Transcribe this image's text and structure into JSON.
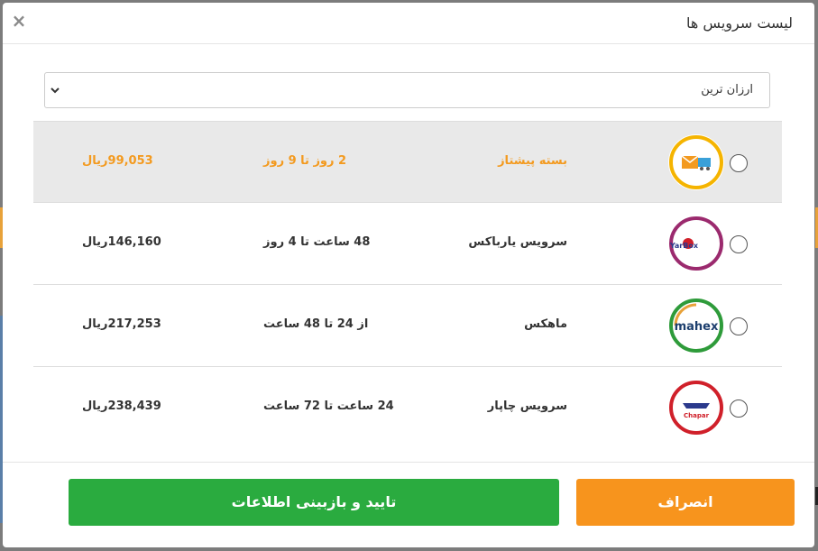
{
  "modal": {
    "title": "لیست سرویس ها",
    "close_glyph": "×"
  },
  "sort": {
    "selected": "ارزان ترین"
  },
  "services": [
    {
      "name": "بسته پیشتاز",
      "time": "2 روز تا 9 روز",
      "price": "99,053ریال",
      "logo_text": "",
      "selected": true,
      "accent": "#f39a1f"
    },
    {
      "name": "سرویس یارباکس",
      "time": "48 ساعت تا 4 روز",
      "price": "146,160ریال",
      "logo_text": "YarBox",
      "selected": false,
      "accent": "#9b2a6e"
    },
    {
      "name": "ماهکس",
      "time": "از 24 تا 48 ساعت",
      "price": "217,253ریال",
      "logo_text": "mahex",
      "selected": false,
      "accent": "#2e9b3a"
    },
    {
      "name": "سرویس چاپار",
      "time": "24 ساعت تا 72 ساعت",
      "price": "238,439ریال",
      "logo_text": "Chapar",
      "selected": false,
      "accent": "#d0202a"
    }
  ],
  "footer": {
    "cancel_label": "انصراف",
    "confirm_label": "تایید و بازبینی اطلاعات"
  },
  "colors": {
    "cancel": "#f7941d",
    "confirm": "#2aab3f",
    "selected_text": "#f39a1f"
  },
  "icons": [
    "close-icon",
    "chevron-down-icon",
    "post-logo-icon",
    "yarbox-logo-icon",
    "mahex-logo-icon",
    "chapar-logo-icon"
  ]
}
